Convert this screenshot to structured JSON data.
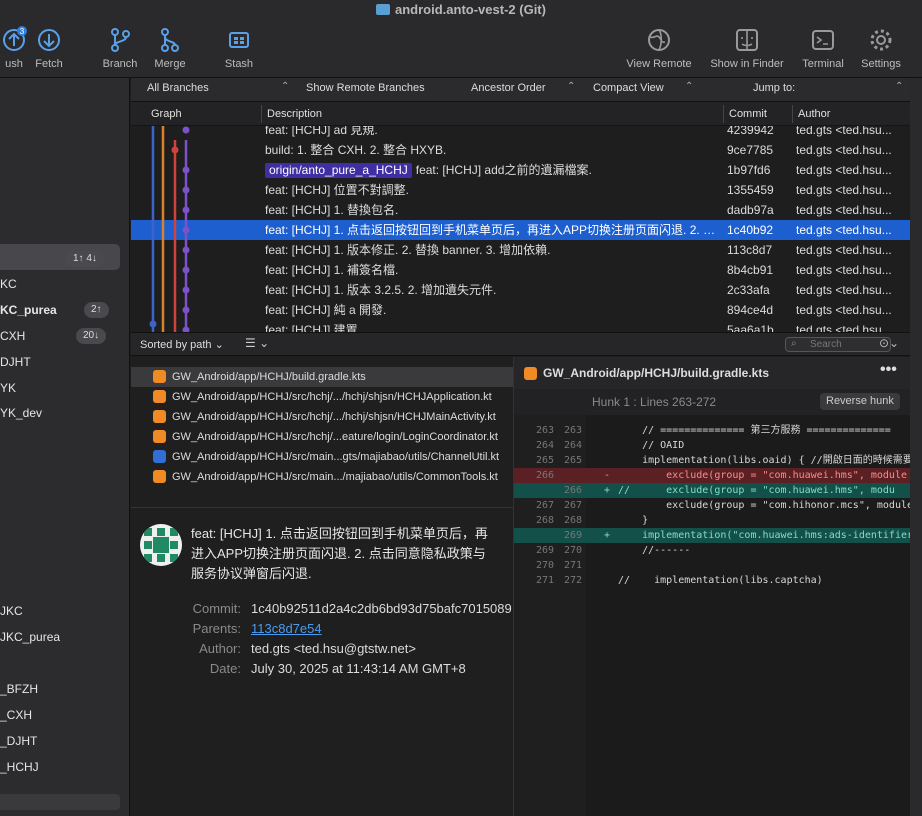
{
  "window": {
    "title": "android.anto-vest-2 (Git)"
  },
  "toolbar": {
    "push": {
      "label": "ush",
      "badge": "3"
    },
    "fetch": {
      "label": "Fetch"
    },
    "branch": {
      "label": "Branch"
    },
    "merge": {
      "label": "Merge"
    },
    "stash": {
      "label": "Stash"
    },
    "view_remote": {
      "label": "View Remote"
    },
    "show_in_finder": {
      "label": "Show in Finder"
    },
    "terminal": {
      "label": "Terminal"
    },
    "settings": {
      "label": "Settings"
    }
  },
  "sidebar": {
    "branches": [
      {
        "label": "",
        "badge": "1↑ 4↓"
      },
      {
        "label": "KC",
        "badge": ""
      },
      {
        "label": "KC_purea",
        "badge": "2↑"
      },
      {
        "label": "CXH",
        "badge": "20↓"
      },
      {
        "label": "DJHT",
        "badge": ""
      },
      {
        "label": "YK",
        "badge": ""
      },
      {
        "label": "YK_dev",
        "badge": ""
      }
    ],
    "remotes": [
      {
        "label": "JKC"
      },
      {
        "label": "JKC_purea"
      },
      {
        "label": ""
      },
      {
        "label": "_BFZH"
      },
      {
        "label": "_CXH"
      },
      {
        "label": "_DJHT"
      },
      {
        "label": "_HCHJ"
      }
    ]
  },
  "filters": {
    "branches": "All Branches",
    "remote": "Show Remote Branches",
    "order": "Ancestor Order",
    "view": "Compact View",
    "jump": "Jump to:"
  },
  "columns": {
    "graph": "Graph",
    "description": "Description",
    "commit": "Commit",
    "author": "Author"
  },
  "commits": [
    {
      "tag": "",
      "desc": "feat: [HCHJ] ad 見規.",
      "commit": "4239942",
      "author": "ted.gts <ted.hsu..."
    },
    {
      "tag": "",
      "desc": "build: 1. 整合 CXH. 2. 整合 HXYB.",
      "commit": "9ce7785",
      "author": "ted.gts <ted.hsu..."
    },
    {
      "tag": "origin/anto_pure_a_HCHJ",
      "desc": "feat: [HCHJ] add之前的遺漏檔案.",
      "commit": "1b97fd6",
      "author": "ted.gts <ted.hsu..."
    },
    {
      "tag": "",
      "desc": "feat: [HCHJ] 位置不對調整.",
      "commit": "1355459",
      "author": "ted.gts <ted.hsu..."
    },
    {
      "tag": "",
      "desc": "feat: [HCHJ] 1. 替換包名.",
      "commit": "dadb97a",
      "author": "ted.gts <ted.hsu..."
    },
    {
      "tag": "",
      "desc": "feat: [HCHJ] 1. 点击返回按钮回到手机菜单页后，再进入APP切换注册页面闪退. 2. 点击同意隐私政策与服务协议弹窗后闪退.",
      "commit": "1c40b92",
      "author": "ted.gts <ted.hsu..."
    },
    {
      "tag": "",
      "desc": "feat: [HCHJ] 1. 版本修正. 2. 替換 banner. 3. 增加依賴.",
      "commit": "113c8d7",
      "author": "ted.gts <ted.hsu..."
    },
    {
      "tag": "",
      "desc": "feat: [HCHJ] 1. 補簽名檔.",
      "commit": "8b4cb91",
      "author": "ted.gts <ted.hsu..."
    },
    {
      "tag": "",
      "desc": "feat: [HCHJ] 1. 版本 3.2.5. 2. 增加遺失元件.",
      "commit": "2c33afa",
      "author": "ted.gts <ted.hsu..."
    },
    {
      "tag": "",
      "desc": "feat: [HCHJ] 純 a 開發.",
      "commit": "894ce4d",
      "author": "ted.gts <ted.hsu..."
    },
    {
      "tag": "",
      "desc": "feat: [HCHJ] 建置.",
      "commit": "5aa6a1b",
      "author": "ted.gts <ted.hsu..."
    }
  ],
  "split": {
    "sorted": "Sorted by path",
    "search_placeholder": "Search"
  },
  "files": [
    {
      "path": "GW_Android/app/HCHJ/build.gradle.kts",
      "icon": "edit-icon"
    },
    {
      "path": "GW_Android/app/HCHJ/src/hchj/.../hchj/shjsn/HCHJApplication.kt",
      "icon": "edit-icon"
    },
    {
      "path": "GW_Android/app/HCHJ/src/hchj/.../hchj/shjsn/HCHJMainActivity.kt",
      "icon": "edit-icon"
    },
    {
      "path": "GW_Android/app/HCHJ/src/hchj/...eature/login/LoginCoordinator.kt",
      "icon": "edit-icon"
    },
    {
      "path": "GW_Android/app/HCHJ/src/main...gts/majiabao/utils/ChannelUtil.kt",
      "icon": "rename-icon"
    },
    {
      "path": "GW_Android/app/HCHJ/src/main.../majiabao/utils/CommonTools.kt",
      "icon": "edit-icon"
    }
  ],
  "commit_info": {
    "message_lines": [
      "feat: [HCHJ] 1. 点击返回按钮回到手机菜单页后，再",
      "进入APP切换注册页面闪退. 2. 点击同意隐私政策与",
      "服务协议弹窗后闪退."
    ],
    "commit_label": "Commit:",
    "commit": "1c40b92511d2a4c2db6bd93d75bafc7015089",
    "parents_label": "Parents:",
    "parents": "113c8d7e54",
    "author_label": "Author:",
    "author": "ted.gts <ted.hsu@gtstw.net>",
    "date_label": "Date:",
    "date": "July 30, 2025 at 11:43:14 AM GMT+8"
  },
  "diff": {
    "file": "GW_Android/app/HCHJ/build.gradle.kts",
    "hunk": "Hunk 1 : Lines 263-272",
    "reverse": "Reverse hunk",
    "lines": [
      {
        "o": "263",
        "n": "263",
        "t": "ctx",
        "m": "",
        "code": "    // ============== 第三方服務 ============== "
      },
      {
        "o": "264",
        "n": "264",
        "t": "ctx",
        "m": "",
        "code": "    // OAID"
      },
      {
        "o": "265",
        "n": "265",
        "t": "ctx",
        "m": "",
        "code": "    implementation(libs.oaid) { //開啟日面的時候需要"
      },
      {
        "o": "266",
        "n": "",
        "t": "rem",
        "m": "-",
        "code": "        exclude(group = \"com.huawei.hms\", module"
      },
      {
        "o": "",
        "n": "266",
        "t": "add",
        "m": "+",
        "code": "//      exclude(group = \"com.huawei.hms\", modu"
      },
      {
        "o": "267",
        "n": "267",
        "t": "ctx",
        "m": "",
        "code": "        exclude(group = \"com.hihonor.mcs\", module"
      },
      {
        "o": "268",
        "n": "268",
        "t": "ctx",
        "m": "",
        "code": "    }"
      },
      {
        "o": "",
        "n": "269",
        "t": "add",
        "m": "+",
        "code": "    implementation(\"com.huawei.hms:ads-identifier"
      },
      {
        "o": "269",
        "n": "270",
        "t": "ctx",
        "m": "",
        "code": "    //------"
      },
      {
        "o": "270",
        "n": "271",
        "t": "ctx",
        "m": "",
        "code": ""
      },
      {
        "o": "271",
        "n": "272",
        "t": "ctx",
        "m": "",
        "code": "//    implementation(libs.captcha)"
      }
    ]
  },
  "colors": {
    "selection": "#1e5fcf",
    "tag": "#3f2fa3",
    "graph_orange": "#d9822b",
    "graph_blue": "#3b63c9",
    "graph_purple": "#7b52c9",
    "graph_red": "#d0433a"
  }
}
